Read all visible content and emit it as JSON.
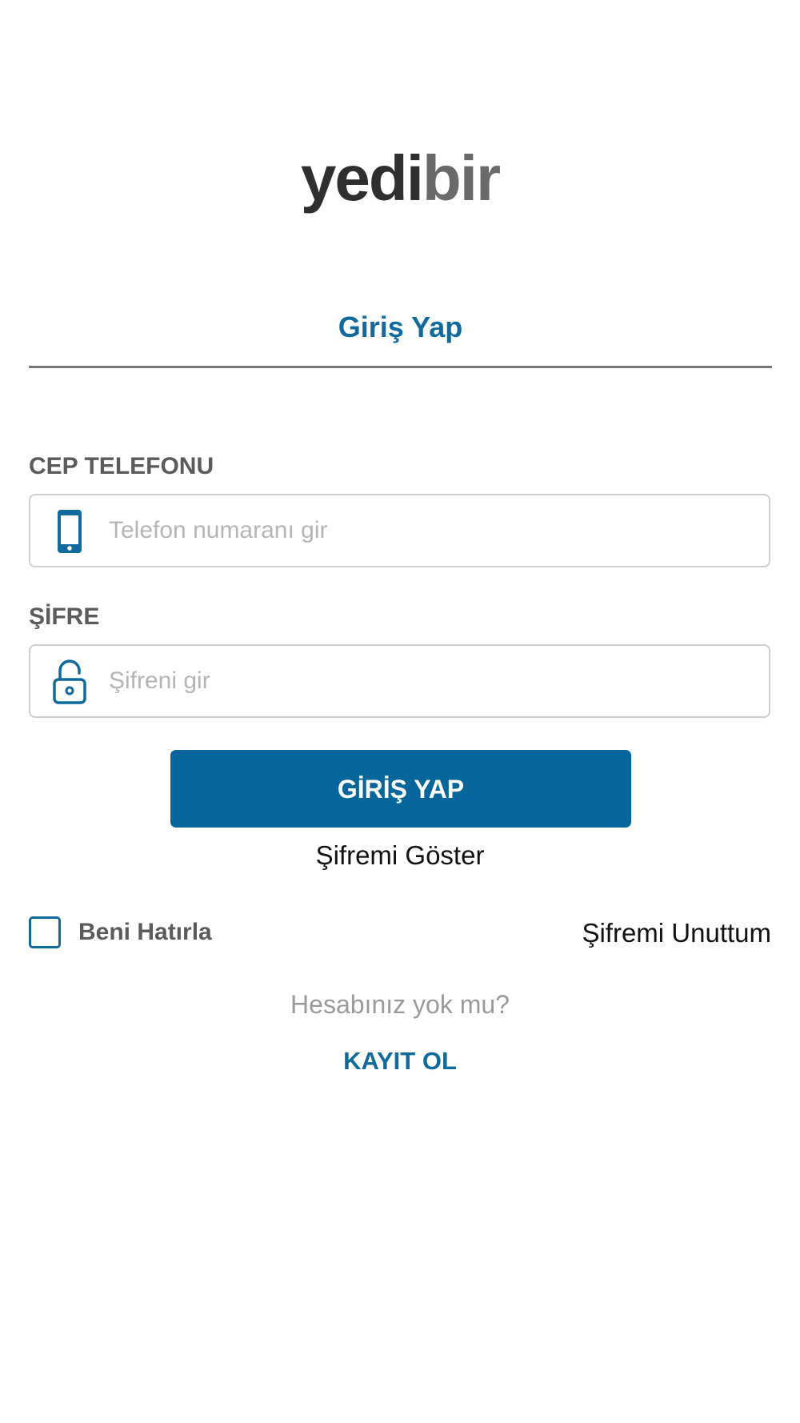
{
  "logo": {
    "part1": "yedi",
    "part2": "bir"
  },
  "tab": {
    "label": "Giriş Yap"
  },
  "phone": {
    "label": "CEP TELEFONU",
    "placeholder": "Telefon numaranı gir",
    "value": "",
    "icon": "mobile-phone-icon"
  },
  "password": {
    "label": "ŞİFRE",
    "placeholder": "Şifreni gir",
    "value": "",
    "icon": "lock-icon"
  },
  "login_button": {
    "label": "GİRİŞ YAP"
  },
  "show_password": {
    "label": "Şifremi Göster"
  },
  "remember_me": {
    "label": "Beni Hatırla",
    "checked": false
  },
  "forgot_password": {
    "label": "Şifremi Unuttum"
  },
  "signup": {
    "prompt": "Hesabınız yok mu?",
    "link": "KAYIT OL"
  },
  "colors": {
    "accent": "#0f6a9e",
    "button": "#06669c",
    "label": "#5b5b5b",
    "placeholder": "#b5b5b5"
  }
}
